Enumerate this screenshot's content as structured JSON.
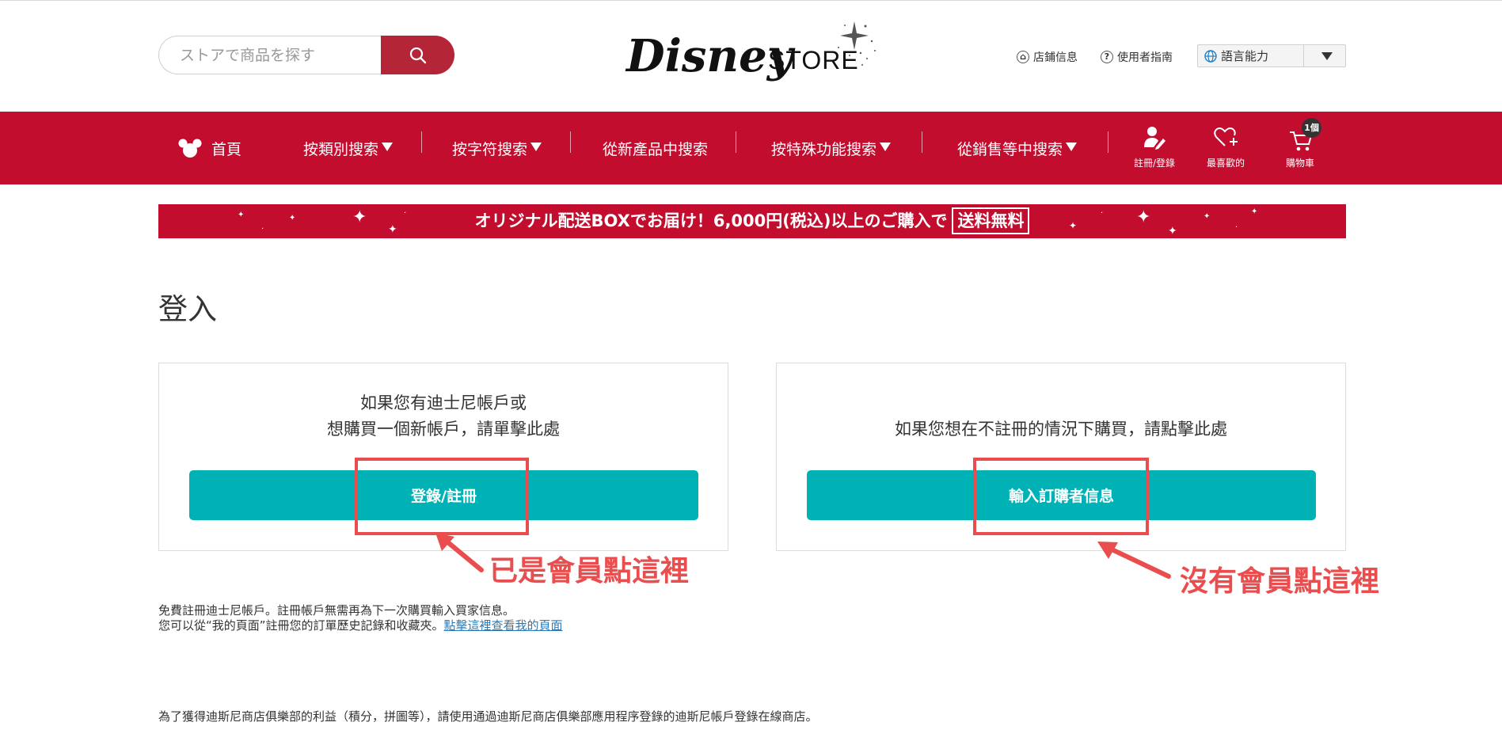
{
  "header": {
    "search": {
      "placeholder": "ストアで商品を探す"
    },
    "logo": {
      "brand": "Disney",
      "store": "STORE"
    },
    "utility": {
      "store_info": "店鋪信息",
      "user_guide": "使用者指南",
      "language_label": "語言能力"
    }
  },
  "nav": {
    "home": "首頁",
    "items": [
      {
        "label": "按類別搜索",
        "dropdown": true
      },
      {
        "label": "按字符搜索",
        "dropdown": true
      },
      {
        "label": "從新產品中搜索",
        "dropdown": false
      },
      {
        "label": "按特殊功能搜索",
        "dropdown": true
      },
      {
        "label": "從銷售等中搜索",
        "dropdown": true
      }
    ],
    "register_login": "註冊/登錄",
    "favorites": "最喜歡的",
    "cart": "購物車",
    "cart_count": "1個"
  },
  "banner": {
    "text": "オリジナル配送BOXでお届け！6,000円(税込)以上のご購入で",
    "tag": "送料無料"
  },
  "main": {
    "title": "登入",
    "member_card": {
      "line1": "如果您有迪士尼帳戶或",
      "line2": "想購買一個新帳戶，請單擊此處",
      "button": "登錄/註冊"
    },
    "guest_card": {
      "line1": "如果您想在不註冊的情況下購買，請點擊此處",
      "button": "輸入訂購者信息"
    },
    "annotations": {
      "member": "已是會員點這裡",
      "guest": "沒有會員點這裡"
    },
    "notes": {
      "line1": "免費註冊迪士尼帳戶。註冊帳戶無需再為下一次購買輸入買家信息。",
      "line2": "您可以從“我的頁面”註冊您的訂單歷史記錄和收藏夾。",
      "link": "點擊這裡查看我的頁面",
      "line3": "為了獲得迪斯尼商店俱樂部的利益（積分，拼圖等），請使用通過迪斯尼商店俱樂部應用程序登錄的迪斯尼帳戶登錄在線商店。"
    }
  },
  "colors": {
    "brand_red": "#c20d2f",
    "search_button": "#b32537",
    "button_teal": "#00b2b5",
    "annotation_red": "#ea4d4d",
    "link_blue": "#2a7ab8"
  }
}
